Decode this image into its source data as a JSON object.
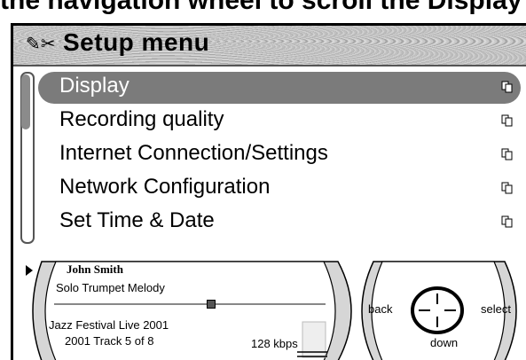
{
  "caption": "the navigation wheel to scroll the Display and the Selection",
  "header": {
    "title": "Setup menu",
    "logo_icon": "hands-icon"
  },
  "menu": {
    "items": [
      {
        "label": "Display",
        "selected": true
      },
      {
        "label": "Recording quality",
        "selected": false
      },
      {
        "label": "Internet Connection/Settings",
        "selected": false
      },
      {
        "label": "Network Configuration",
        "selected": false
      },
      {
        "label": "Set Time & Date",
        "selected": false
      }
    ]
  },
  "player": {
    "artist": "John Smith",
    "track": "Solo Trumpet Melody",
    "album": "Jazz Festival Live 2001",
    "info": "2001  Track 5 of 8",
    "bitrate": "128 kbps",
    "progress": 0.6
  },
  "nav": {
    "back": "back",
    "select": "select",
    "down": "down"
  },
  "colors": {
    "selected_bg": "#7b7b7b",
    "header_bg": "#b8b8b8"
  }
}
